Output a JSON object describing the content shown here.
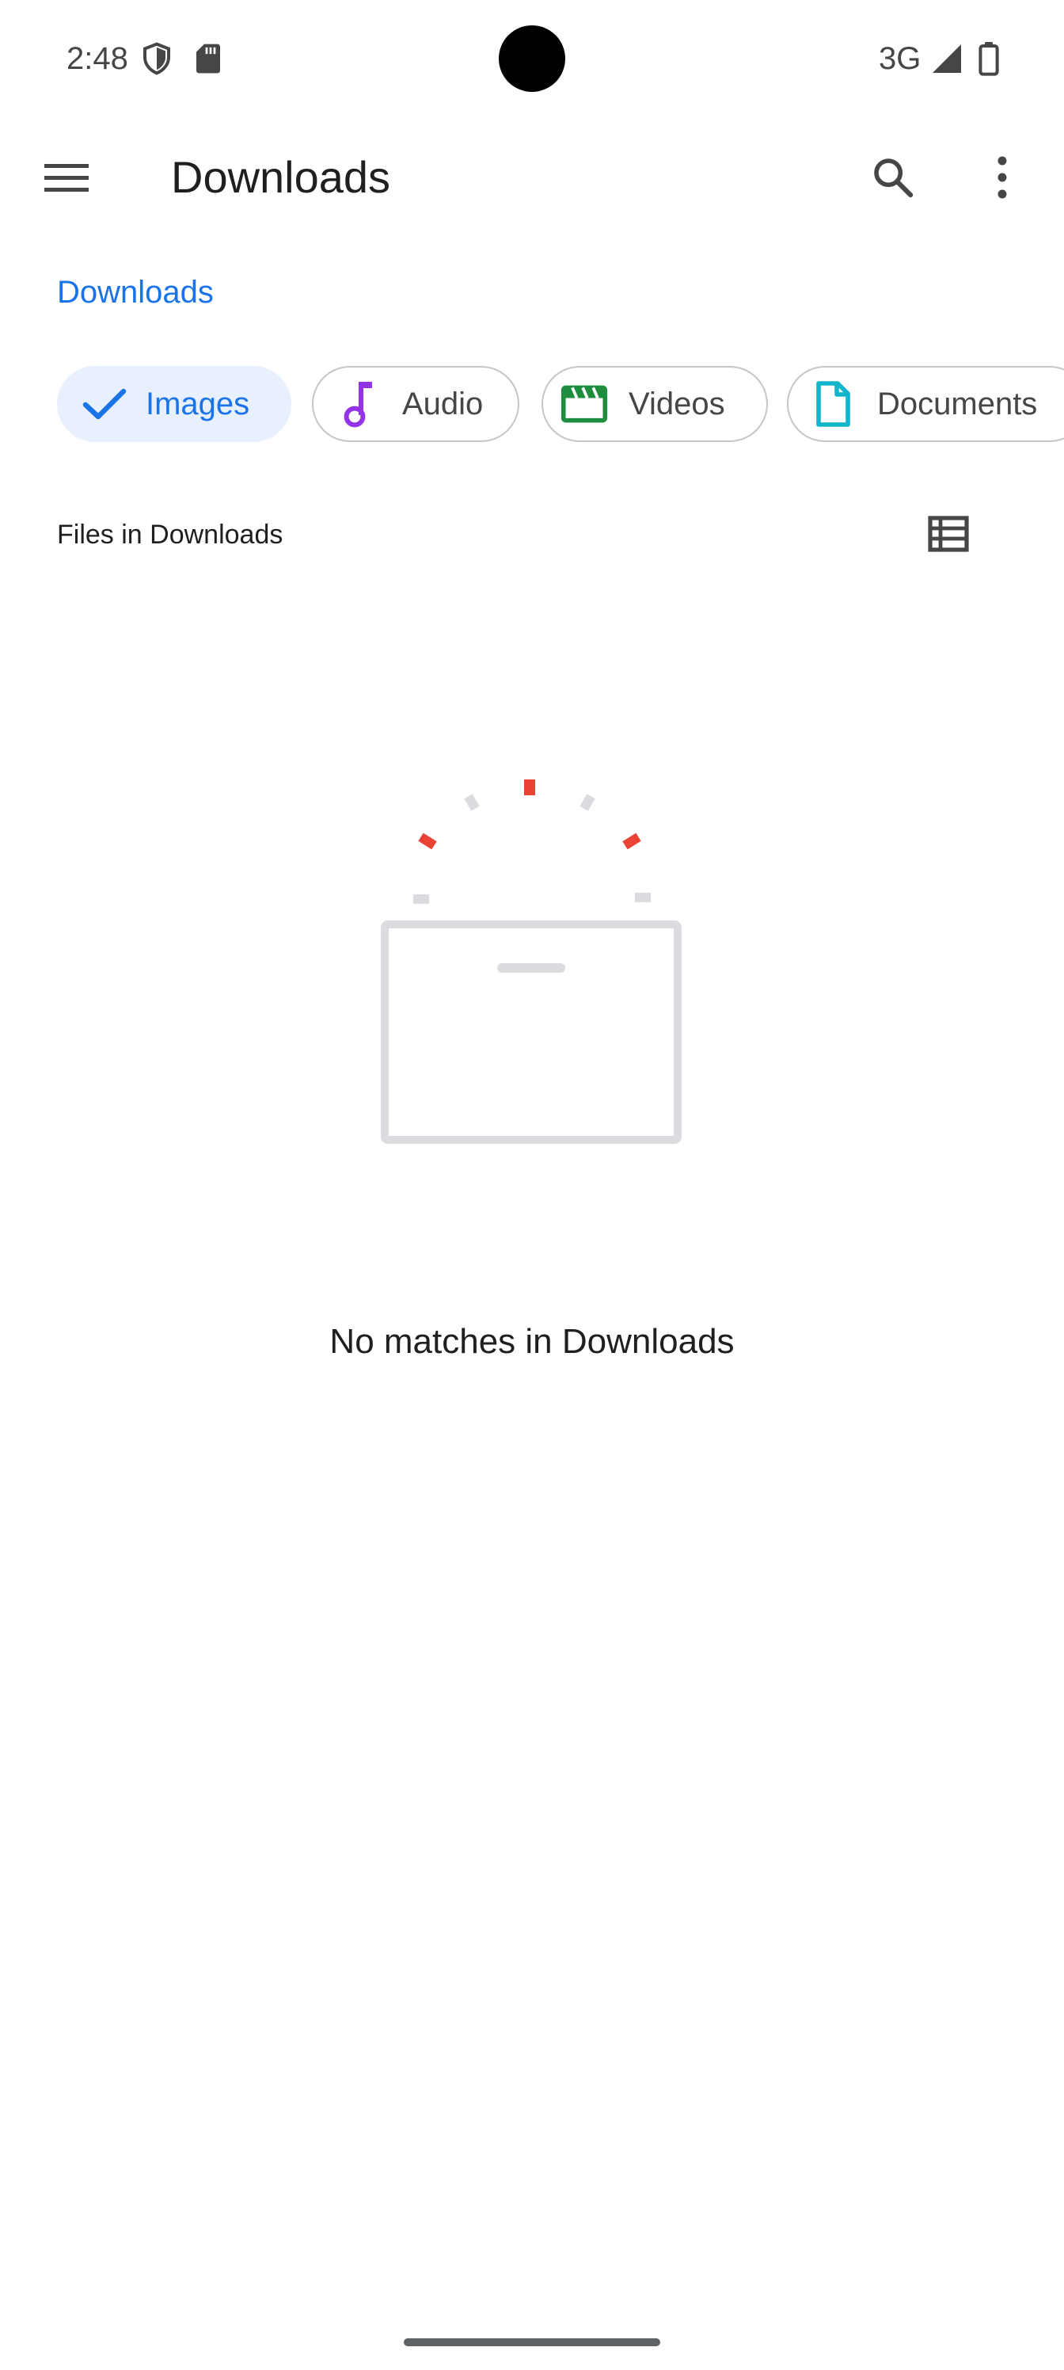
{
  "status_bar": {
    "time": "2:48",
    "network": "3G"
  },
  "toolbar": {
    "title": "Downloads"
  },
  "breadcrumb": {
    "label": "Downloads"
  },
  "filters": {
    "chips": [
      {
        "label": "Images",
        "selected": true,
        "icon": "check-icon"
      },
      {
        "label": "Audio",
        "selected": false,
        "icon": "music-note-icon"
      },
      {
        "label": "Videos",
        "selected": false,
        "icon": "movie-icon"
      },
      {
        "label": "Documents",
        "selected": false,
        "icon": "document-icon"
      }
    ]
  },
  "section": {
    "title": "Files in Downloads"
  },
  "empty_state": {
    "message": "No matches in Downloads"
  },
  "colors": {
    "accent": "#1a73e8",
    "selected_chip_bg": "#e8f0fe",
    "audio_icon": "#9334e6",
    "video_icon": "#1e8e3e",
    "document_icon": "#12b5cb",
    "illustration_red": "#ea4335",
    "illustration_gray": "#dadce0"
  }
}
